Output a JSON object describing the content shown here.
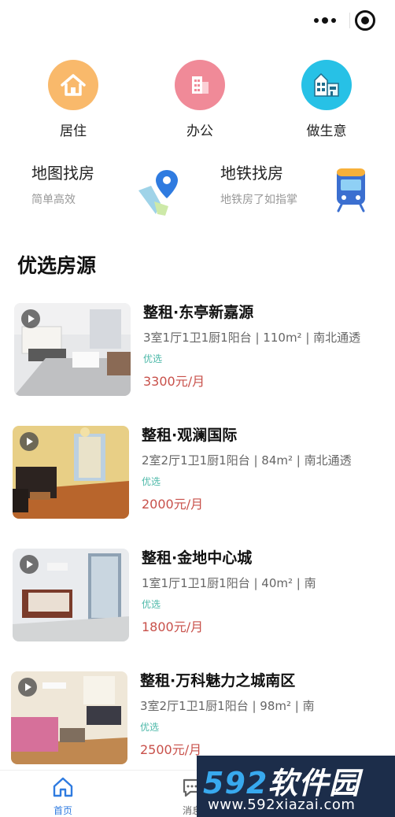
{
  "capsule": {
    "more_icon": "more-dots-icon",
    "close_icon": "target-icon"
  },
  "categories": [
    {
      "label": "居住",
      "icon": "house-icon",
      "color": "#f9b96b"
    },
    {
      "label": "办公",
      "icon": "office-building-icon",
      "color": "#f08a98"
    },
    {
      "label": "做生意",
      "icon": "shop-building-icon",
      "color": "#27c1e6"
    }
  ],
  "finders": [
    {
      "title": "地图找房",
      "subtitle": "简单高效",
      "icon": "map-pin-icon"
    },
    {
      "title": "地铁找房",
      "subtitle": "地铁房了如指掌",
      "icon": "subway-train-icon"
    }
  ],
  "section_title": "优选房源",
  "listings": [
    {
      "name": "整租·东亭新嘉源",
      "spec": "3室1厅1卫1厨1阳台 | 110m² | 南北通透",
      "tag": "优选",
      "price": "3300元/月"
    },
    {
      "name": "整租·观澜国际",
      "spec": "2室2厅1卫1厨1阳台 | 84m² | 南北通透",
      "tag": "优选",
      "price": "2000元/月"
    },
    {
      "name": "整租·金地中心城",
      "spec": "1室1厅1卫1厨1阳台 | 40m² | 南",
      "tag": "优选",
      "price": "1800元/月"
    },
    {
      "name": "整租·万科魅力之城南区",
      "spec": "3室2厅1卫1厨1阳台 | 98m² | 南",
      "tag": "优选",
      "price": "2500元/月"
    }
  ],
  "tabbar": [
    {
      "label": "首页",
      "icon": "home-icon",
      "active": true
    },
    {
      "label": "消息",
      "icon": "message-icon",
      "active": false
    }
  ],
  "watermark": {
    "number": "592",
    "brand": "软件园",
    "url": "www.592xiazai.com"
  },
  "colors": {
    "accent": "#2f7be0",
    "price": "#c8504a",
    "tag": "#4bb8a8"
  }
}
